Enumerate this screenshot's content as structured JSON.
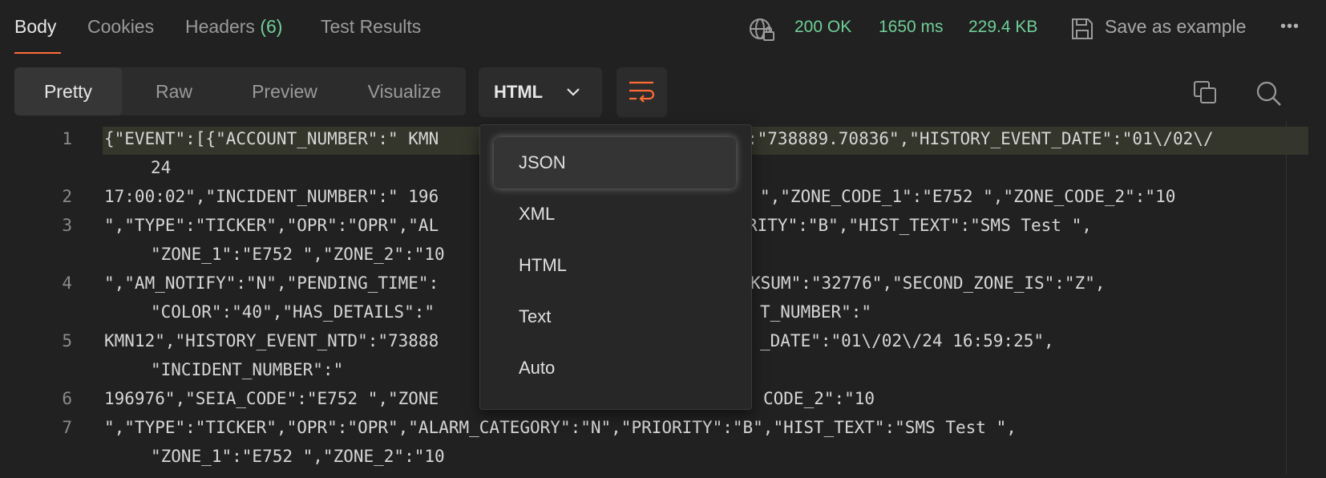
{
  "tabs": {
    "body": "Body",
    "cookies": "Cookies",
    "headers": "Headers",
    "headers_count": "(6)",
    "test_results": "Test Results"
  },
  "status": {
    "code": "200 OK",
    "time": "1650 ms",
    "size": "229.4 KB",
    "save": "Save as example",
    "more": "•••"
  },
  "view_modes": {
    "pretty": "Pretty",
    "raw": "Raw",
    "preview": "Preview",
    "visualize": "Visualize"
  },
  "format": {
    "selected": "HTML",
    "options": [
      "JSON",
      "XML",
      "HTML",
      "Text",
      "Auto"
    ]
  },
  "editor": {
    "line_numbers": [
      "1",
      "2",
      "3",
      "4",
      "5",
      "6",
      "7"
    ],
    "lines": [
      "{\"EVENT\":[{\"ACCOUNT_NUMBER\":\" KMN",
      "24",
      "17:00:02\",\"INCIDENT_NUMBER\":\" 196",
      "\",\"TYPE\":\"TICKER\",\"OPR\":\"OPR\",\"AL",
      "\"ZONE_1\":\"E752 \",\"ZONE_2\":\"10",
      "\",\"AM_NOTIFY\":\"N\",\"PENDING_TIME\":",
      "\"COLOR\":\"40\",\"HAS_DETAILS\":\"",
      "KMN12\",\"HISTORY_EVENT_NTD\":\"73888",
      "\"INCIDENT_NUMBER\":\"",
      "196976\",\"SEIA_CODE\":\"E752 \",\"ZONE",
      "\",\"TYPE\":\"TICKER\",\"OPR\":\"OPR\",\"ALARM_CATEGORY\":\"N\",\"PRIORITY\":\"B\",\"HIST_TEXT\":\"SMS Test \",",
      "\"ZONE_1\":\"E752 \",\"ZONE_2\":\"10"
    ],
    "right_fragments": [
      ":\"738889.70836\",\"HISTORY_EVENT_DATE\":\"01\\/02\\/",
      "\",\"ZONE_CODE_1\":\"E752 \",\"ZONE_CODE_2\":\"10",
      "RITY\":\"B\",\"HIST_TEXT\":\"SMS Test \",",
      "KSUM\":\"32776\",\"SECOND_ZONE_IS\":\"Z\",",
      "T_NUMBER\":\"",
      "_DATE\":\"01\\/02\\/24 16:59:25\",",
      "CODE_2\":\"10"
    ]
  }
}
